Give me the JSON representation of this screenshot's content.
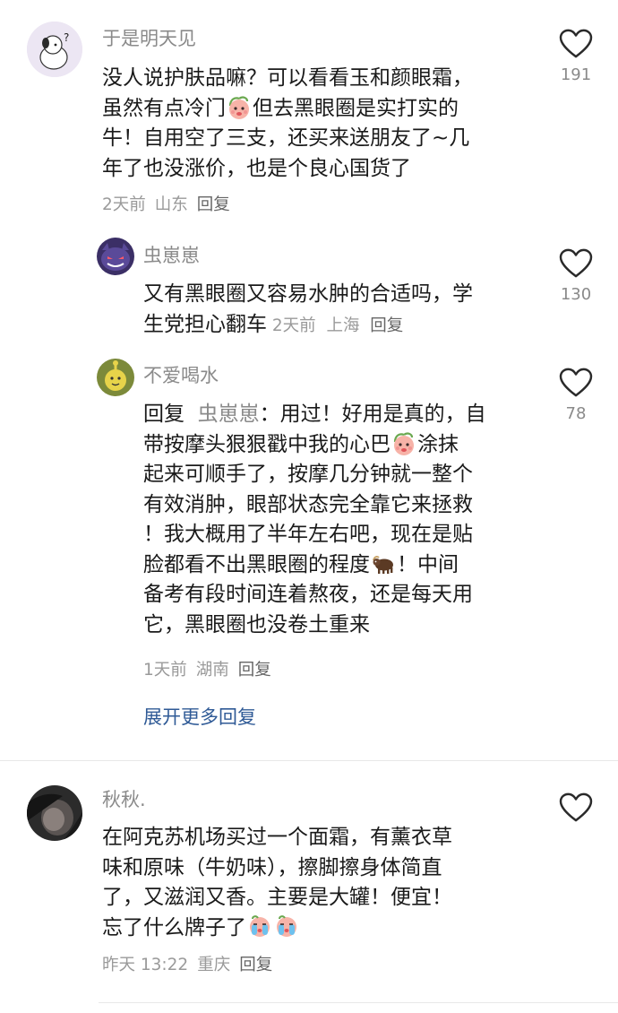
{
  "comments": [
    {
      "user": "于是明天见",
      "lines": [
        "没人说护肤品嘛？可以看看玉和颜眼霜，",
        "虽然有点冷门",
        "但去黑眼圈是实打实的",
        "牛！自用空了三支，还买来送朋友了~几",
        "年了也没涨价，也是个良心国货了"
      ],
      "meta_time": "2天前",
      "meta_location": "山东",
      "meta_reply": "回复",
      "likes": "191",
      "replies": [
        {
          "user": "虫崽崽",
          "lines": [
            "又有黑眼圈又容易水肿的合适吗，学",
            "生党担心翻车"
          ],
          "meta_time": "2天前",
          "meta_location": "上海",
          "meta_reply": "回复",
          "likes": "130"
        },
        {
          "user": "不爱喝水",
          "reply_prefix": "回复",
          "reply_target": "虫崽崽",
          "lines": [
            "：用过！好用是真的，自",
            "带按摩头狠狠戳中我的心巴",
            "涂抹",
            "起来可顺手了，按摩几分钟就一整个",
            "有效消肿，眼部状态完全靠它来拯救",
            "！我大概用了半年左右吧，现在是贴",
            "脸都看不出黑眼圈的程度",
            "！中间",
            "备考有段时间连着熬夜，还是每天用",
            "它，黑眼圈也没卷土重来"
          ],
          "meta_time": "1天前",
          "meta_location": "湖南",
          "meta_reply": "回复",
          "likes": "78"
        }
      ],
      "expand_label": "展开更多回复"
    },
    {
      "user": "秋秋.",
      "lines": [
        "在阿克苏机场买过一个面霜，有薰衣草",
        "味和原味（牛奶味），擦脚擦身体简直",
        "了，又滋润又香。主要是大罐！便宜！",
        "忘了什么牌子了"
      ],
      "meta_time": "昨天 13:22",
      "meta_location": "重庆",
      "meta_reply": "回复",
      "likes": ""
    }
  ],
  "icons": {
    "like": "heart-outline-icon",
    "emoji_peach": "peach-face-emoji",
    "emoji_ox": "ox-emoji",
    "emoji_crying": "crying-peach-emoji"
  },
  "colors": {
    "username": "#8a8a8a",
    "meta": "#9a9a9a",
    "link": "#2f5a96"
  }
}
